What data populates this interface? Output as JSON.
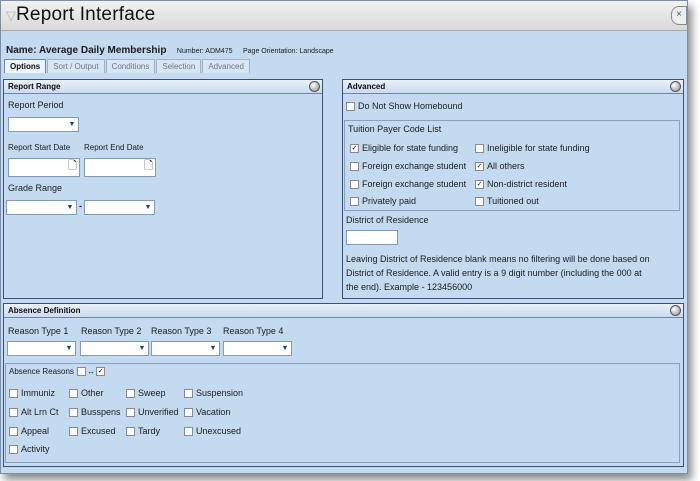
{
  "window": {
    "title": "Report Interface",
    "funnel_icon": "filter-icon",
    "close_icon": "close-icon"
  },
  "meta": {
    "name": "Name: Average Daily Membership",
    "number": "Number: ADM475",
    "orientation": "Page Orientation: Landscape"
  },
  "tabs": [
    "Options",
    "Sort / Output",
    "Conditions",
    "Selection",
    "Advanced"
  ],
  "report_range": {
    "title": "Report Range",
    "period_label": "Report Period",
    "start_label": "Report Start Date",
    "end_label": "Report End Date",
    "grade_label": "Grade Range",
    "grade_sep": "-"
  },
  "advanced": {
    "title": "Advanced",
    "homebound_label": "Do Not Show Homebound",
    "tuition_legend": "Tuition Payer Code List",
    "tuition_items": [
      {
        "label": "Eligible for state funding",
        "checked": true
      },
      {
        "label": "Ineligible for state funding",
        "checked": false
      },
      {
        "label": "Foreign exchange student",
        "checked": false
      },
      {
        "label": "All others",
        "checked": true
      },
      {
        "label": "Foreign exchange student",
        "checked": false
      },
      {
        "label": "Non-district resident",
        "checked": true
      },
      {
        "label": "Privately paid",
        "checked": false
      },
      {
        "label": "Tuitioned out",
        "checked": false
      }
    ],
    "district_label": "District of Residence",
    "district_value": "",
    "note_lines": [
      "Leaving District of Residence blank means no filtering will be done based on",
      "District of Residence. A valid entry is a 9 digit number (including the 000 at",
      "the end). Example - 123456000"
    ]
  },
  "absence": {
    "title": "Absence Definition",
    "reason_types": [
      "Reason Type 1",
      "Reason Type 2",
      "Reason Type 3",
      "Reason Type 4"
    ],
    "reasons_legend": "Absence Reasons",
    "reasons_toggle": "↔",
    "reasons": [
      "Immuniz",
      "Other",
      "Sweep",
      "Suspension",
      "Alt Lrn Ct",
      "Busspens",
      "Unverified",
      "Vacation",
      "Appeal",
      "Excused",
      "Tardy",
      "Unexcused",
      "Activity"
    ]
  },
  "colors": {
    "background": "#c3daf0",
    "panel_border": "#3b4f7a",
    "check_mark": "#111111"
  }
}
